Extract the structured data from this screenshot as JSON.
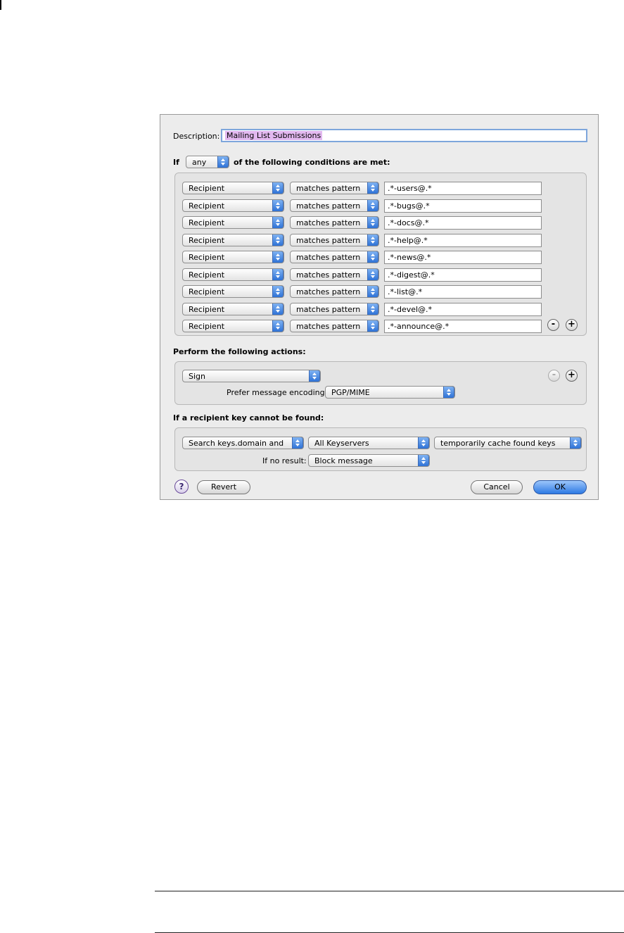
{
  "description": {
    "label": "Description:",
    "value": "Mailing List Submissions"
  },
  "conditions": {
    "prefix": "If",
    "match": "any",
    "suffix": "of the following conditions are met:",
    "rows": [
      {
        "field": "Recipient",
        "operator": "matches pattern",
        "value": ".*-users@.*"
      },
      {
        "field": "Recipient",
        "operator": "matches pattern",
        "value": ".*-bugs@.*"
      },
      {
        "field": "Recipient",
        "operator": "matches pattern",
        "value": ".*-docs@.*"
      },
      {
        "field": "Recipient",
        "operator": "matches pattern",
        "value": ".*-help@.*"
      },
      {
        "field": "Recipient",
        "operator": "matches pattern",
        "value": ".*-news@.*"
      },
      {
        "field": "Recipient",
        "operator": "matches pattern",
        "value": ".*-digest@.*"
      },
      {
        "field": "Recipient",
        "operator": "matches pattern",
        "value": ".*-list@.*"
      },
      {
        "field": "Recipient",
        "operator": "matches pattern",
        "value": ".*-devel@.*"
      },
      {
        "field": "Recipient",
        "operator": "matches pattern",
        "value": ".*-announce@.*"
      }
    ],
    "remove_glyph": "-",
    "add_glyph": "+"
  },
  "actions": {
    "heading": "Perform the following actions:",
    "action": "Sign",
    "encoding_label": "Prefer message encoding:",
    "encoding": "PGP/MIME",
    "remove_glyph": "-",
    "add_glyph": "+"
  },
  "missing_key": {
    "heading": "If a recipient key cannot be found:",
    "search": "Search keys.domain and",
    "keyservers": "All Keyservers",
    "cache": "temporarily cache found keys",
    "no_result_label": "If no result:",
    "no_result": "Block message"
  },
  "footer": {
    "help": "?",
    "revert": "Revert",
    "cancel": "Cancel",
    "ok": "OK"
  },
  "colors": {
    "accent": "#2d79e3",
    "selection": "#e2b8f0"
  }
}
